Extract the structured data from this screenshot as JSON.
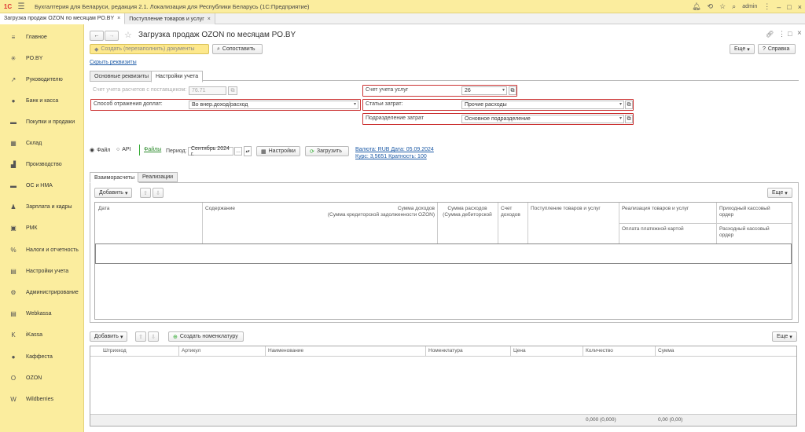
{
  "app": {
    "title": "Бухгалтерия для Беларуси, редакция 2.1. Локализация для Республики Беларусь   (1С:Предприятие)",
    "user": "admin"
  },
  "tabs": [
    {
      "label": "Загрузка продаж OZON по месяцам PO.BY"
    },
    {
      "label": "Поступление товаров и услуг"
    }
  ],
  "sidebar": [
    {
      "label": "Главное",
      "icon": "≡"
    },
    {
      "label": "PO.BY",
      "icon": "✳"
    },
    {
      "label": "Руководителю",
      "icon": "↗"
    },
    {
      "label": "Банк и касса",
      "icon": "●"
    },
    {
      "label": "Покупки и продажи",
      "icon": "▬"
    },
    {
      "label": "Склад",
      "icon": "▦"
    },
    {
      "label": "Производство",
      "icon": "▟"
    },
    {
      "label": "ОС и НМА",
      "icon": "▬"
    },
    {
      "label": "Зарплата и кадры",
      "icon": "♟"
    },
    {
      "label": "РМК",
      "icon": "▣"
    },
    {
      "label": "Налоги и отчетность",
      "icon": "%"
    },
    {
      "label": "Настройки учета",
      "icon": "▤"
    },
    {
      "label": "Администрирование",
      "icon": "⚙"
    },
    {
      "label": "Webkassa",
      "icon": "▤"
    },
    {
      "label": "iKassa",
      "icon": "K"
    },
    {
      "label": "Каффеста",
      "icon": "●"
    },
    {
      "label": "OZON",
      "icon": "O"
    },
    {
      "label": "Wildberries",
      "icon": "W"
    }
  ],
  "header": {
    "title": "Загрузка продаж OZON по месяцам PO.BY",
    "more": "Еще",
    "help": "Справка"
  },
  "toolbar": {
    "create": "Создать (перезаполнить) документы",
    "compare": "Сопоставить",
    "hide_link": "Скрыть реквизиты"
  },
  "form_tabs": [
    {
      "label": "Основные реквизиты"
    },
    {
      "label": "Настройки учета"
    }
  ],
  "settings": {
    "supplier_label": "Счет учета расчетов с поставщиком:",
    "supplier_value": "76.71",
    "method_label": "Способ отражения доплат:",
    "method_value": "Во внер.доход/расход",
    "service_account_label": "Счет учета услуг",
    "service_account_value": "26",
    "cost_items_label": "Статьи затрат:",
    "cost_items_value": "Прочие расходы",
    "cost_dept_label": "Подразделение затрат",
    "cost_dept_value": "Основное подразделение"
  },
  "load": {
    "file": "Файл",
    "api": "API",
    "files_link": "Файлы",
    "period_label": "Период:",
    "period_value": "Сентябрь 2024 г.",
    "settings_btn": "Настройки",
    "load_btn": "Загрузить",
    "currency": "Валюта: RUB Дата: 05.09.2024",
    "rate": "Курс: 3,5651 Кратность: 100"
  },
  "inner_tabs": [
    {
      "label": "Взаиморасчеты"
    },
    {
      "label": "Реализации"
    }
  ],
  "grid1": {
    "add": "Добавить",
    "more": "Еще",
    "cols": [
      "Дата",
      "Содержание",
      "Сумма доходов\n(Сумма кредиторской задолженности OZON)",
      "Сумма расходов\n(Сумма дебиторской",
      "Счет\nдоходов",
      "Поступление товаров и услуг",
      "Реализация товаров и услуг",
      "Приходный кассовый\nордер",
      "Оплата платежной картой",
      "Расходный кассовый\nордер"
    ]
  },
  "grid2": {
    "add": "Добавить",
    "create_nom": "Создать номенклатуру",
    "more": "Еще",
    "cols": [
      "Штрихкод",
      "Артикул",
      "Наименование",
      "Номенклатура",
      "Цена",
      "Количество",
      "Сумма"
    ],
    "total_qty": "0,000 (0,000)",
    "total_sum": "0,00 (0,00)"
  }
}
